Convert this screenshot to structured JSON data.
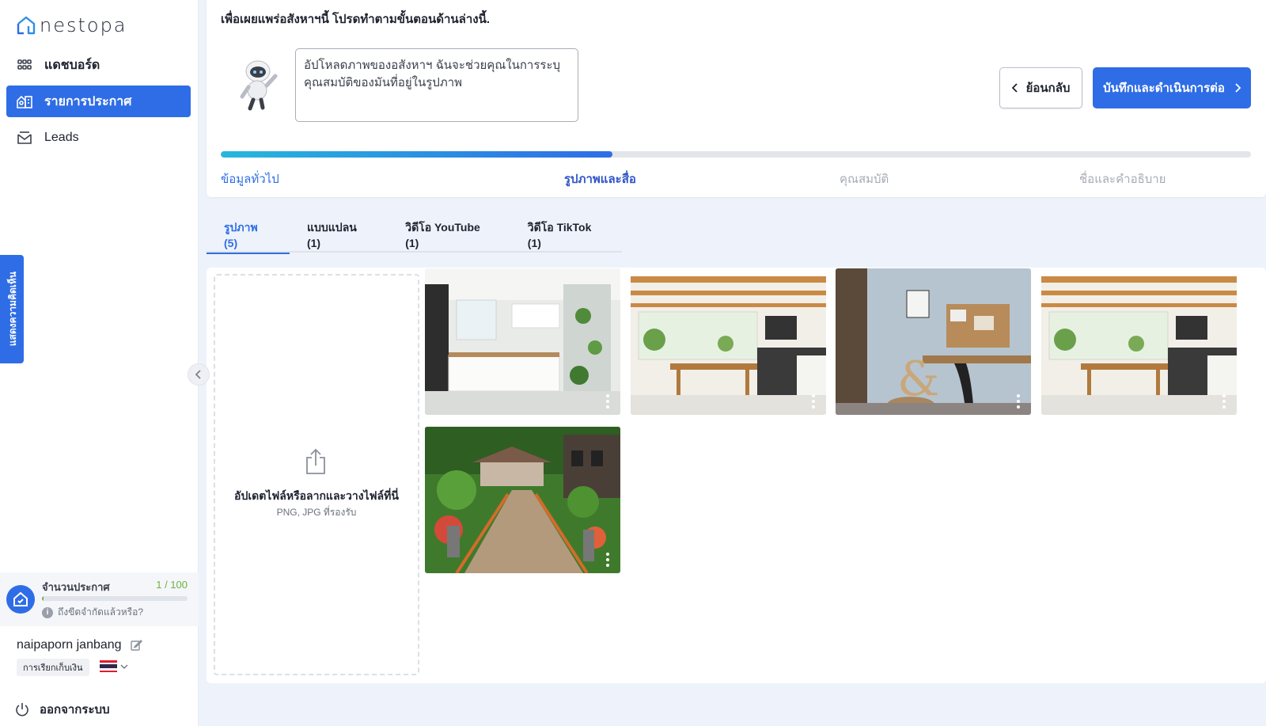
{
  "brand": {
    "name": "nestopa",
    "color": "#2f6de6"
  },
  "sidebar": {
    "items": [
      {
        "label": "แดชบอร์ด",
        "icon": "grid-icon",
        "active": false
      },
      {
        "label": "รายการประกาศ",
        "icon": "listing-icon",
        "active": true
      },
      {
        "label": "Leads",
        "icon": "mail-icon",
        "active": false
      }
    ],
    "side_tab": "แสดงความคิดเห็น",
    "quota": {
      "title": "จำนวนประกาศ",
      "count": "1 / 100",
      "fill_fraction": 0.01,
      "help": "ถึงขีดจำกัดแล้วหรือ?"
    },
    "user": {
      "name": "naipaporn janbang",
      "billing": "การเรียกเก็บเงิน"
    },
    "logout": "ออกจากระบบ"
  },
  "header": {
    "intro": "เพื่อเผยแพร่อสังหาฯนี้ โปรดทำตามขั้นตอนด้านล่างนี้.",
    "assistant_message": "อัปโหลดภาพของอสังหาฯ ฉันจะช่วยคุณในการระบุคุณสมบัติของมันที่อยู่ในรูปภาพ",
    "back_label": "ย้อนกลับ",
    "save_label": "บันทึกและดำเนินการต่อ",
    "progress_fraction": 0.38,
    "steps": [
      {
        "label": "ข้อมูลทั่วไป",
        "state": "done"
      },
      {
        "label": "รูปภาพและสื่อ",
        "state": "current"
      },
      {
        "label": "คุณสมบัติ",
        "state": "pending"
      },
      {
        "label": "ชื่อและคำอธิบาย",
        "state": "pending"
      }
    ]
  },
  "tabs": [
    {
      "label": "รูปภาพ (5)",
      "active": true
    },
    {
      "label": "แบบแปลน (1)",
      "active": false
    },
    {
      "label": "วิดีโอ YouTube (1)",
      "active": false
    },
    {
      "label": "วิดีโอ TikTok (1)",
      "active": false
    }
  ],
  "upload": {
    "title": "อัปเดตไฟล์หรือลากและวางไฟล์ที่นี่",
    "subtitle": "PNG, JPG ที่รองรับ"
  },
  "photos": [
    {
      "name": "photo-kitchen-white"
    },
    {
      "name": "photo-kitchen-beams"
    },
    {
      "name": "photo-workspace"
    },
    {
      "name": "photo-kitchen-beams-2"
    },
    {
      "name": "photo-garden-walkway"
    }
  ]
}
